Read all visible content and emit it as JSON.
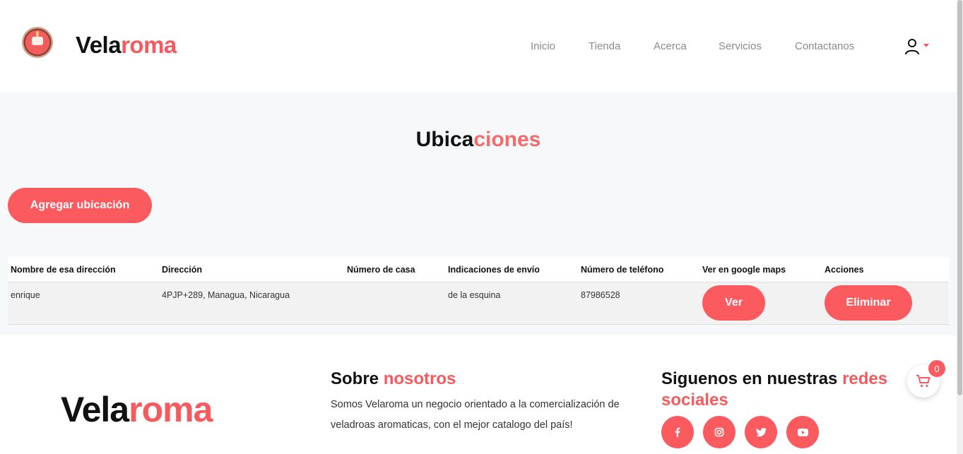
{
  "header": {
    "brand_part1": "Vela",
    "brand_part2": "roma",
    "nav": [
      "Inicio",
      "Tienda",
      "Acerca",
      "Servicios",
      "Contactanos"
    ]
  },
  "main": {
    "title_part1": "Ubica",
    "title_part2": "ciones",
    "add_button": "Agregar ubicación",
    "columns": [
      "Nombre de esa dirección",
      "Dirección",
      "Número de casa",
      "Indicaciones de envío",
      "Número de teléfono",
      "Ver en google maps",
      "Acciones"
    ],
    "rows": [
      {
        "name": "enrique",
        "address": "4PJP+289, Managua, Nicaragua",
        "house_number": "",
        "directions": "de la esquina",
        "phone": "87986528",
        "view_label": "Ver",
        "delete_label": "Eliminar"
      }
    ]
  },
  "footer": {
    "brand_part1": "Vela",
    "brand_part2": "roma",
    "about_title_part1": "Sobre",
    "about_title_part2": "nosotros",
    "about_text": "Somos Velaroma un negocio orientado a la comercialización de veladroas aromaticas, con el mejor catalogo del país!",
    "social_title_part1": "Siguenos en nuestras",
    "social_title_part2": "redes sociales",
    "social_icons": [
      "facebook-icon",
      "instagram-icon",
      "twitter-icon",
      "youtube-icon"
    ]
  },
  "cart": {
    "count": "0"
  },
  "colors": {
    "accent": "#fb5a5e",
    "background": "#f7f8fa"
  }
}
